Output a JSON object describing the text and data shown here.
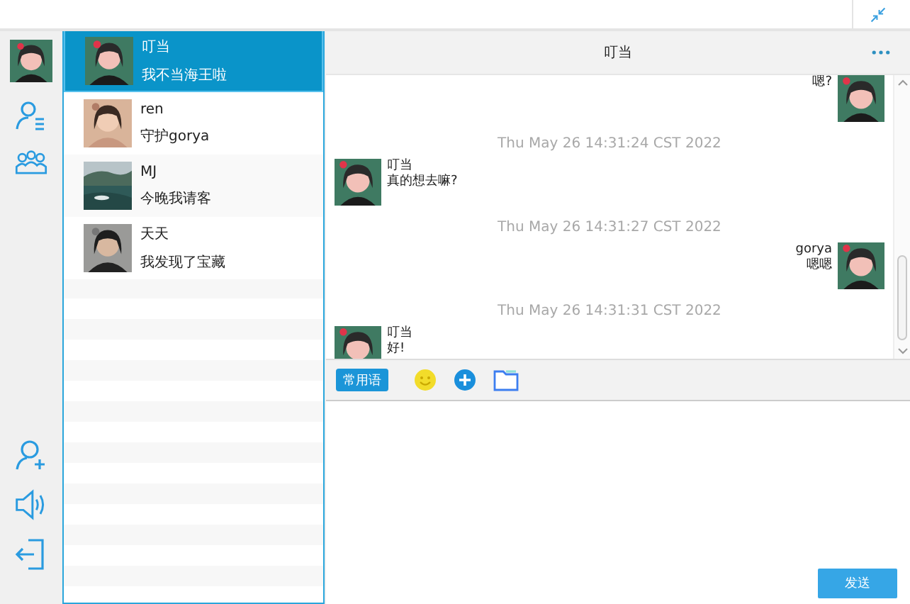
{
  "contacts": [
    {
      "name": "叮当",
      "message": "我不当海王啦",
      "selected": true
    },
    {
      "name": "ren",
      "message": "守护gorya",
      "selected": false
    },
    {
      "name": "MJ",
      "message": "今晚我请客",
      "selected": false
    },
    {
      "name": "天天",
      "message": "我发现了宝藏",
      "selected": false
    }
  ],
  "chat": {
    "title": "叮当",
    "messages": [
      {
        "kind": "outgoing",
        "text": "嗯?"
      },
      {
        "kind": "time",
        "text": "Thu May 26 14:31:24 CST 2022"
      },
      {
        "kind": "incoming",
        "sender": "叮当",
        "text": "真的想去嘛?"
      },
      {
        "kind": "time",
        "text": "Thu May 26 14:31:27 CST 2022"
      },
      {
        "kind": "outgoing",
        "sender": "gorya",
        "text": "嗯嗯"
      },
      {
        "kind": "time",
        "text": "Thu May 26 14:31:31 CST 2022"
      },
      {
        "kind": "incoming",
        "sender": "叮当",
        "text": "好!"
      }
    ],
    "phrases_button": "常用语",
    "send_button": "发送"
  }
}
